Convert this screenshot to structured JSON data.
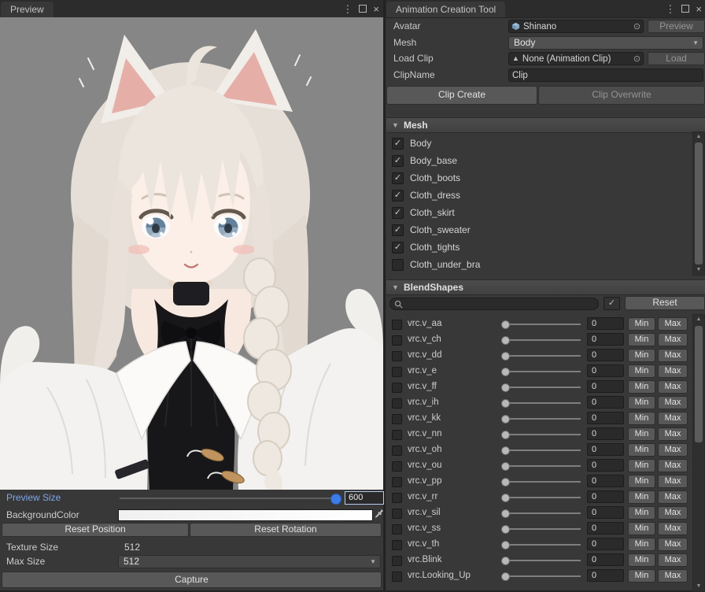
{
  "icons": {
    "kebab": "⋮",
    "close": "×",
    "foldout": "▼",
    "dropdown": "▼",
    "picker": "⊙",
    "check": "✓",
    "clip_triangle": "▲",
    "scroll_up": "▲",
    "scroll_down": "▼"
  },
  "colors": {
    "accent_blue": "#3e7de7",
    "label_blue": "#7ca7e6",
    "panel": "#383838",
    "field": "#2a2a2a"
  },
  "left_window": {
    "tab_label": "Preview",
    "preview_size": {
      "label": "Preview Size",
      "value": "600"
    },
    "background_color": {
      "label": "BackgroundColor"
    },
    "reset_position_label": "Reset Position",
    "reset_rotation_label": "Reset Rotation",
    "texture_size": {
      "label": "Texture Size",
      "value": "512"
    },
    "max_size": {
      "label": "Max Size",
      "value": "512"
    },
    "capture_label": "Capture"
  },
  "right_window": {
    "title": "Animation Creation Tool",
    "rows": {
      "avatar": {
        "label": "Avatar",
        "value": "Shinano",
        "button": "Preview"
      },
      "mesh": {
        "label": "Mesh",
        "value": "Body"
      },
      "load_clip": {
        "label": "Load Clip",
        "value": "None (Animation Clip)",
        "button": "Load"
      },
      "clip_name": {
        "label": "ClipName",
        "value": "Clip"
      }
    },
    "actions": {
      "clip_create": "Clip Create",
      "clip_overwrite": "Clip Overwrite"
    },
    "mesh_section": {
      "header": "Mesh",
      "items": [
        {
          "label": "Body",
          "checked": true
        },
        {
          "label": "Body_base",
          "checked": true
        },
        {
          "label": "Cloth_boots",
          "checked": true
        },
        {
          "label": "Cloth_dress",
          "checked": true
        },
        {
          "label": "Cloth_skirt",
          "checked": true
        },
        {
          "label": "Cloth_sweater",
          "checked": true
        },
        {
          "label": "Cloth_tights",
          "checked": true
        },
        {
          "label": "Cloth_under_bra",
          "checked": false
        }
      ]
    },
    "blendshapes": {
      "header": "BlendShapes",
      "reset_label": "Reset",
      "min_label": "Min",
      "max_label": "Max",
      "rows": [
        {
          "name": "vrc.v_aa",
          "value": "0"
        },
        {
          "name": "vrc.v_ch",
          "value": "0"
        },
        {
          "name": "vrc.v_dd",
          "value": "0"
        },
        {
          "name": "vrc.v_e",
          "value": "0"
        },
        {
          "name": "vrc.v_ff",
          "value": "0"
        },
        {
          "name": "vrc.v_ih",
          "value": "0"
        },
        {
          "name": "vrc.v_kk",
          "value": "0"
        },
        {
          "name": "vrc.v_nn",
          "value": "0"
        },
        {
          "name": "vrc.v_oh",
          "value": "0"
        },
        {
          "name": "vrc.v_ou",
          "value": "0"
        },
        {
          "name": "vrc.v_pp",
          "value": "0"
        },
        {
          "name": "vrc.v_rr",
          "value": "0"
        },
        {
          "name": "vrc.v_sil",
          "value": "0"
        },
        {
          "name": "vrc.v_ss",
          "value": "0"
        },
        {
          "name": "vrc.v_th",
          "value": "0"
        },
        {
          "name": "vrc.Blink",
          "value": "0"
        },
        {
          "name": "vrc.Looking_Up",
          "value": "0"
        }
      ]
    }
  }
}
